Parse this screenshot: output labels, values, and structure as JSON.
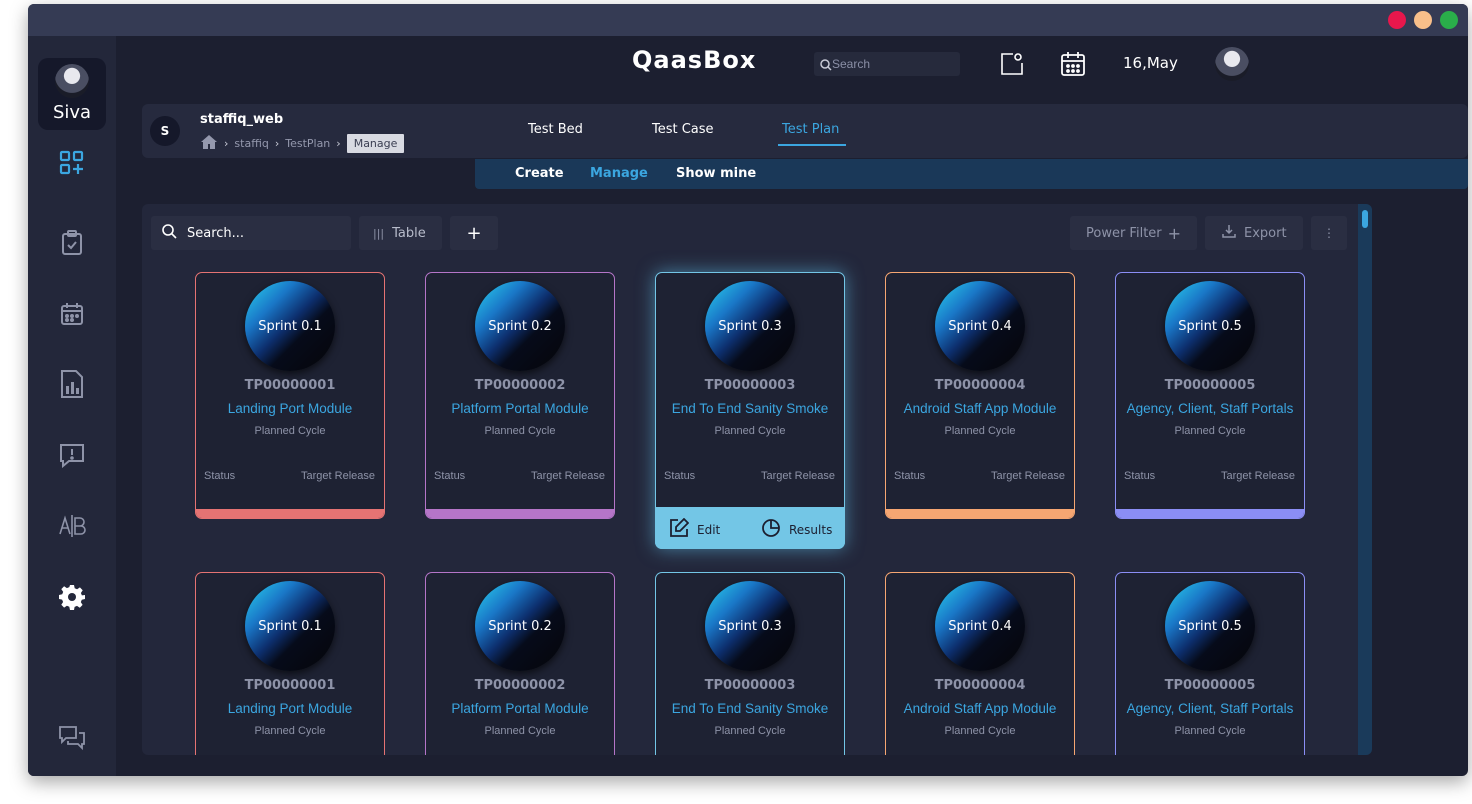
{
  "window": {
    "traffic_colors": [
      "#e8174c",
      "#f8bf8a",
      "#2aae4a"
    ]
  },
  "sidebar": {
    "profile_name": "Siva",
    "icons": [
      "dashboard-add-icon",
      "clipboard-check-icon",
      "calendar-icon",
      "report-icon",
      "alert-message-icon",
      "ab-test-icon",
      "gear-icon",
      "chat-icon"
    ]
  },
  "header": {
    "logo": "QaasBox",
    "search_placeholder": "Search",
    "date": "16,May"
  },
  "project": {
    "badge": "S",
    "name": "staffiq_web",
    "breadcrumb": [
      "staffiq",
      "TestPlan"
    ],
    "breadcrumb_current": "Manage"
  },
  "tabs": [
    "Test Bed",
    "Test Case",
    "Test Plan"
  ],
  "active_tab": "Test Plan",
  "subnav": [
    "Create",
    "Manage",
    "Show mine"
  ],
  "active_subnav": "Manage",
  "toolbar": {
    "search_placeholder": "Search...",
    "view_label": "Table",
    "add_label": "+",
    "power_filter_label": "Power Filter",
    "export_label": "Export"
  },
  "card_labels": {
    "cycle": "Planned Cycle",
    "status": "Status",
    "target_release": "Target Release",
    "edit": "Edit",
    "results": "Results"
  },
  "cards": [
    {
      "sprint": "Sprint 0.1",
      "id": "TP00000001",
      "name": "Landing Port Module",
      "color": "#e57373"
    },
    {
      "sprint": "Sprint 0.2",
      "id": "TP00000002",
      "name": "Platform Portal Module",
      "color": "#b575c8"
    },
    {
      "sprint": "Sprint 0.3",
      "id": "TP00000003",
      "name": "End To End Sanity Smoke",
      "color": "#73c6e6"
    },
    {
      "sprint": "Sprint 0.4",
      "id": "TP00000004",
      "name": "Android Staff App Module",
      "color": "#f6a672"
    },
    {
      "sprint": "Sprint 0.5",
      "id": "TP00000005",
      "name": "Agency, Client, Staff Portals",
      "color": "#8b8ef5"
    },
    {
      "sprint": "Sprint 0.1",
      "id": "TP00000001",
      "name": "Landing Port Module",
      "color": "#e57373"
    },
    {
      "sprint": "Sprint 0.2",
      "id": "TP00000002",
      "name": "Platform Portal Module",
      "color": "#b575c8"
    },
    {
      "sprint": "Sprint 0.3",
      "id": "TP00000003",
      "name": "End To End Sanity Smoke",
      "color": "#73c6e6"
    },
    {
      "sprint": "Sprint 0.4",
      "id": "TP00000004",
      "name": "Android Staff App Module",
      "color": "#f6a672"
    },
    {
      "sprint": "Sprint 0.5",
      "id": "TP00000005",
      "name": "Agency, Client, Staff Portals",
      "color": "#8b8ef5"
    }
  ],
  "highlighted_card": 2
}
